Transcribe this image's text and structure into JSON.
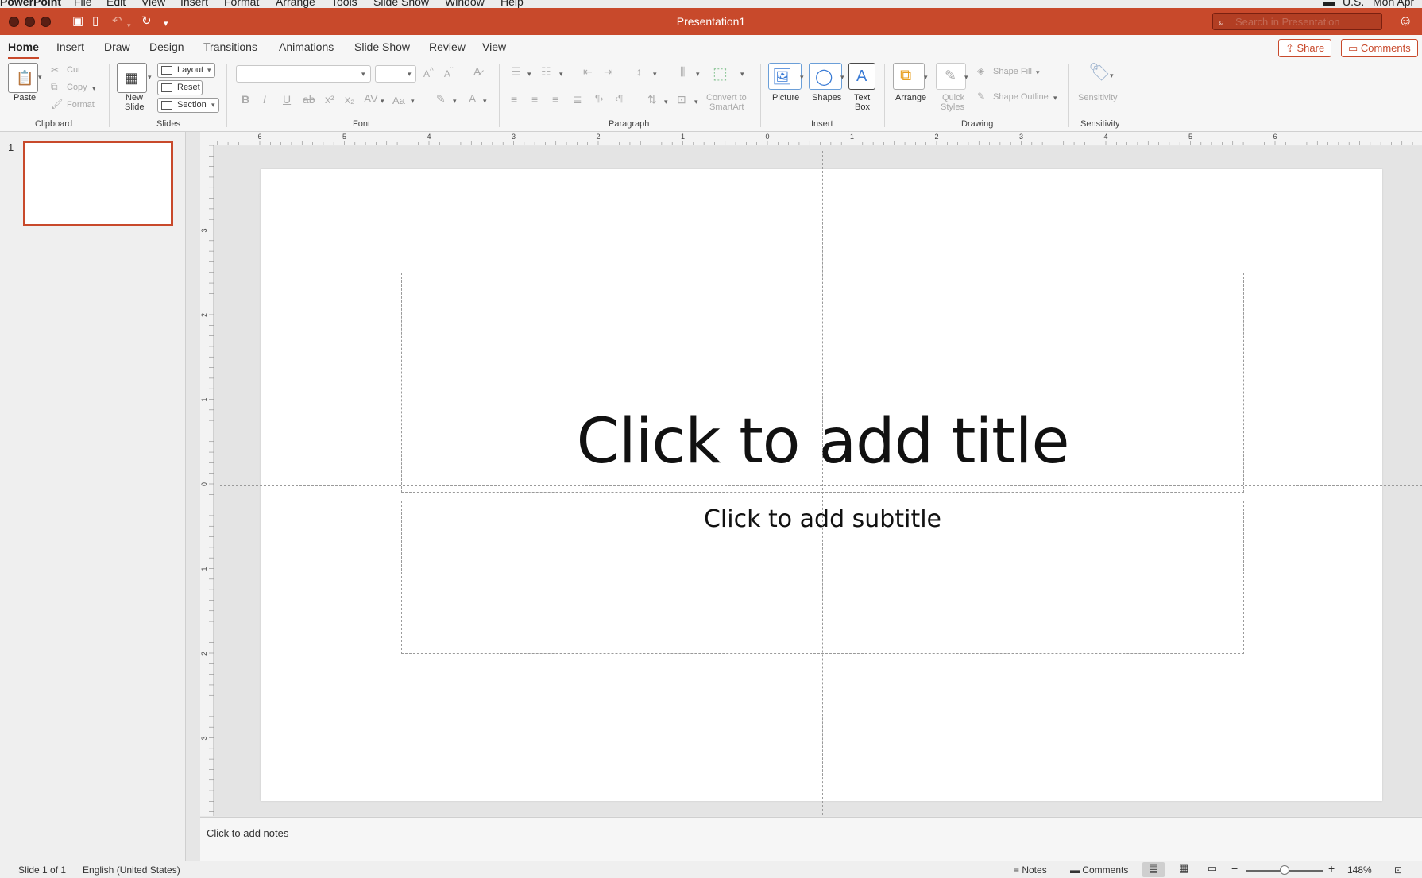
{
  "menubar": {
    "app": "PowerPoint",
    "items": [
      "File",
      "Edit",
      "View",
      "Insert",
      "Format",
      "Arrange",
      "Tools",
      "Slide Show",
      "Window",
      "Help"
    ],
    "right_locale": "U.S.",
    "clock": "Mon Apr"
  },
  "window": {
    "title": "Presentation1",
    "search_placeholder": "Search in Presentation"
  },
  "tabs": [
    "Home",
    "Insert",
    "Draw",
    "Design",
    "Transitions",
    "Animations",
    "Slide Show",
    "Review",
    "View"
  ],
  "active_tab": "Home",
  "header_buttons": {
    "share": "Share",
    "comments": "Comments"
  },
  "ribbon": {
    "clipboard": {
      "paste": "Paste",
      "cut": "Cut",
      "copy": "Copy",
      "format": "Format",
      "group": "Clipboard"
    },
    "slides": {
      "new_slide_1": "New",
      "new_slide_2": "Slide",
      "layout": "Layout",
      "reset": "Reset",
      "section": "Section",
      "group": "Slides"
    },
    "font": {
      "group": "Font",
      "change_case": "Aa"
    },
    "paragraph": {
      "convert_1": "Convert to",
      "convert_2": "SmartArt",
      "group": "Paragraph"
    },
    "insert": {
      "picture": "Picture",
      "shapes": "Shapes",
      "textbox_1": "Text",
      "textbox_2": "Box",
      "group": "Insert"
    },
    "drawing": {
      "arrange": "Arrange",
      "quick_styles_1": "Quick",
      "quick_styles_2": "Styles",
      "shape_fill": "Shape Fill",
      "shape_outline": "Shape Outline",
      "group": "Drawing"
    },
    "sensitivity": {
      "label": "Sensitivity",
      "group": "Sensitivity"
    }
  },
  "ruler": {
    "horizontal": [
      "6",
      "5",
      "4",
      "3",
      "2",
      "1",
      "0",
      "1",
      "2",
      "3",
      "4",
      "5",
      "6"
    ],
    "vertical": [
      "3",
      "2",
      "1",
      "0",
      "1",
      "2",
      "3"
    ]
  },
  "thumbnails": [
    {
      "number": "1"
    }
  ],
  "slide": {
    "title_placeholder": "Click to add title",
    "subtitle_placeholder": "Click to add subtitle"
  },
  "notes_placeholder": "Click to add notes",
  "statusbar": {
    "slide_info": "Slide 1 of 1",
    "language": "English (United States)",
    "notes": "Notes",
    "comments": "Comments",
    "zoom": "148%",
    "zoom_level": 0.5
  },
  "colors": {
    "accent": "#c8492b",
    "canvas": "#e4e4e4",
    "slide": "#ffffff"
  }
}
